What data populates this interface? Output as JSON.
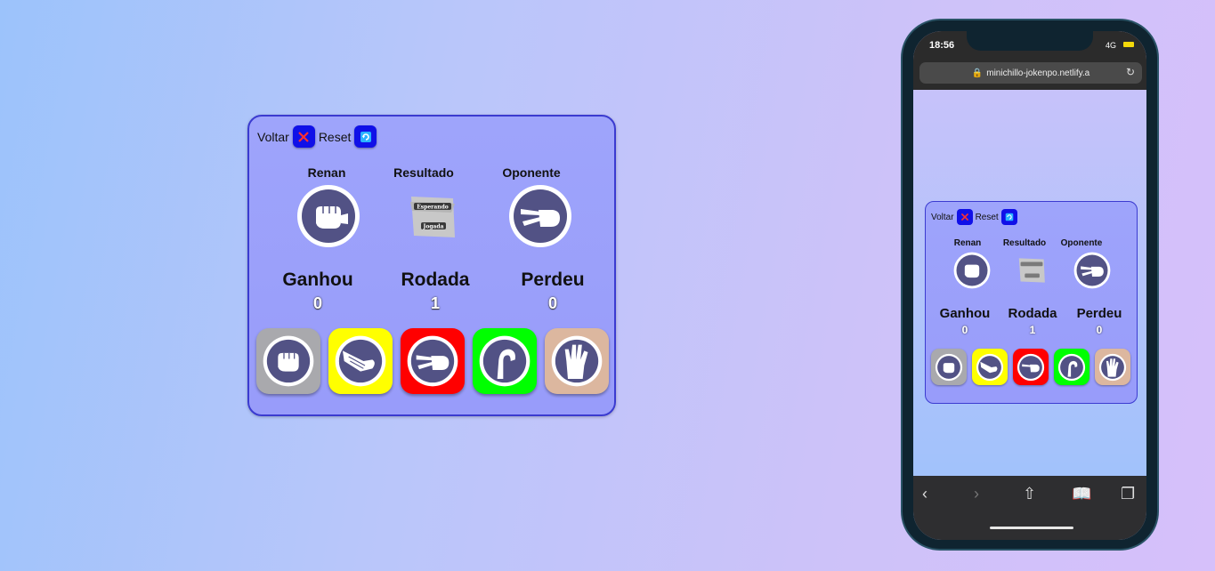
{
  "game": {
    "back_label": "Voltar",
    "reset_label": "Reset",
    "player_label": "Renan",
    "result_label": "Resultado",
    "opponent_label": "Oponente",
    "waiting_line1": "Esperando",
    "waiting_line2": "Jogada",
    "player_choice": "rock",
    "opponent_choice": "scissors",
    "won_label": "Ganhou",
    "won_value": "0",
    "round_label": "Rodada",
    "round_value": "1",
    "lost_label": "Perdeu",
    "lost_value": "0",
    "choices": [
      {
        "name": "rock",
        "color": "#a9a9ad"
      },
      {
        "name": "paper",
        "color": "#ffff00"
      },
      {
        "name": "scissors",
        "color": "#ff0000"
      },
      {
        "name": "lizard",
        "color": "#00ff00"
      },
      {
        "name": "spock",
        "color": "#dcb79f"
      }
    ]
  },
  "phone": {
    "time": "18:56",
    "network": "4G",
    "url": "minichillo-jokenpo.netlify.a"
  },
  "colors": {
    "card_border": "#3b3bd0",
    "button_blue": "#1010e8",
    "icon_navy": "#525285"
  }
}
